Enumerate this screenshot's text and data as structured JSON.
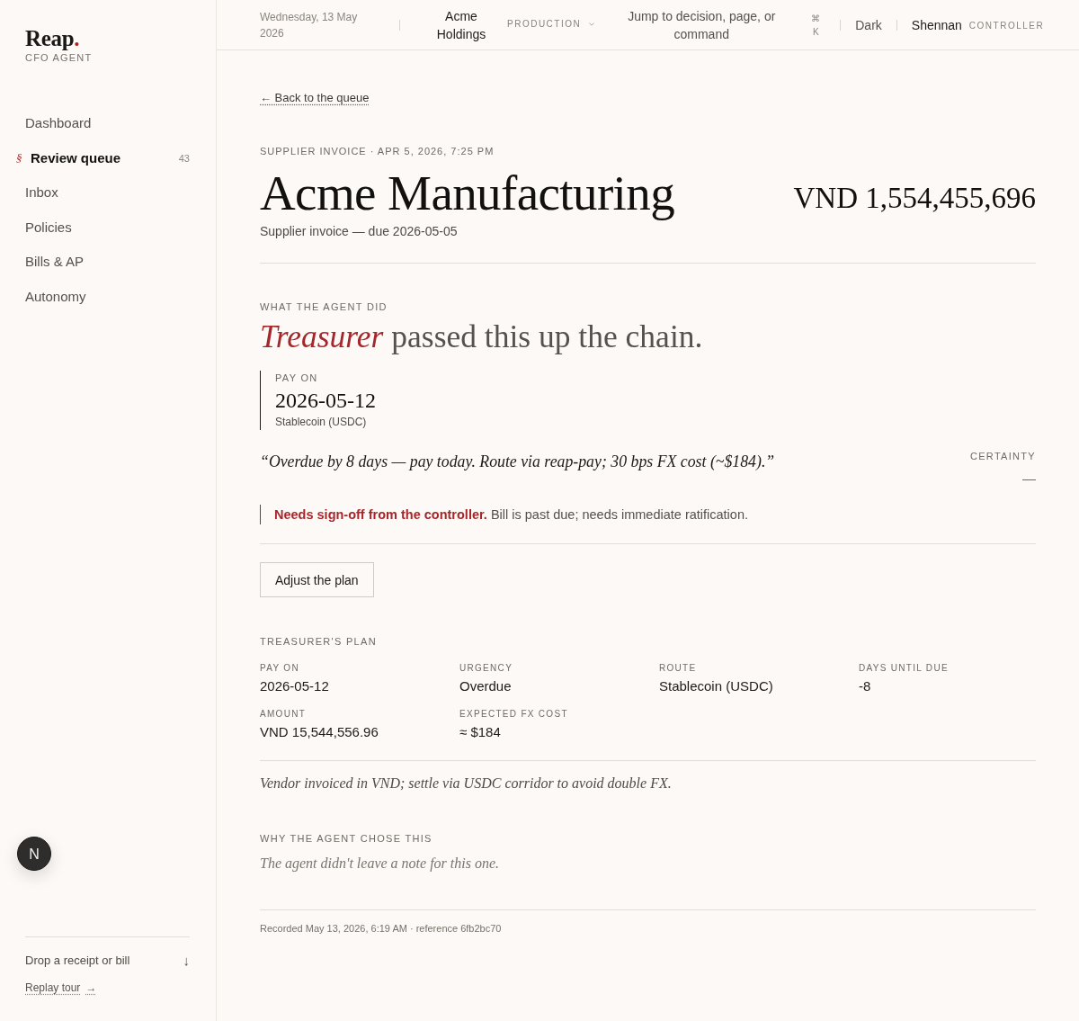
{
  "sidebar": {
    "brand": {
      "name": "Reap",
      "dot": ".",
      "tagline": "CFO AGENT"
    },
    "active_marker": "§",
    "nav": [
      {
        "label": "Dashboard",
        "selected": false
      },
      {
        "label": "Review queue",
        "selected": true,
        "count": "43"
      },
      {
        "label": "Inbox",
        "selected": false
      },
      {
        "label": "Policies",
        "selected": false
      },
      {
        "label": "Bills & AP",
        "selected": false
      },
      {
        "label": "Autonomy",
        "selected": false
      }
    ],
    "footer": {
      "drop_label": "Drop a receipt or bill",
      "drop_arrow": "↓",
      "replay_label": "Replay tour",
      "replay_arrow": "→"
    }
  },
  "floating_button": {
    "letter": "N"
  },
  "top_bar": {
    "date": "Wednesday, 13 May 2026",
    "organization": "Acme Holdings",
    "environment": "PRODUCTION",
    "search_label": "Jump to decision, page, or command",
    "shortcut": "⌘ K",
    "theme": "Dark",
    "user": "Shennan",
    "role": "CONTROLLER"
  },
  "back_link": "← Back to the queue",
  "header": {
    "eyebrow": "SUPPLIER INVOICE · APR 5, 2026, 7:25 PM",
    "title": "Acme Manufacturing",
    "subtitle": "Supplier invoice — due 2026-05-05",
    "amount": "VND 1,554,455,696"
  },
  "agent_action": {
    "label": "WHAT THE AGENT DID",
    "headline": "*Treasurer* passed this up the chain.",
    "decision": {
      "label": "PAY ON",
      "value": "2026-05-12",
      "detail": "Stablecoin (USDC)"
    },
    "quote": "“Overdue by 8 days — pay today. Route via reap-pay; 30 bps FX cost (~$184).”",
    "certainty": {
      "label": "CERTAINTY",
      "value": "—"
    },
    "notice": "**Needs sign-off from the controller.** Bill is past due; needs immediate ratification.",
    "button": "Adjust the plan"
  },
  "plan": {
    "label": "TREASURER'S PLAN",
    "fields": [
      {
        "label": "PAY ON",
        "value": "2026-05-12"
      },
      {
        "label": "URGENCY",
        "value": "Overdue"
      },
      {
        "label": "ROUTE",
        "value": "Stablecoin (USDC)"
      },
      {
        "label": "DAYS UNTIL DUE",
        "value": "-8"
      },
      {
        "label": "AMOUNT",
        "value": "VND 15,544,556.96"
      },
      {
        "label": "EXPECTED FX COST",
        "value": "≈ $184"
      }
    ],
    "note": "Vendor invoiced in VND; settle via USDC corridor to avoid double FX."
  },
  "reasoning": {
    "label": "WHY THE AGENT CHOSE THIS",
    "text": "The agent didn't leave a note for this one."
  },
  "record": "Recorded May 13, 2026, 6:19 AM · reference 6fb2bc70"
}
